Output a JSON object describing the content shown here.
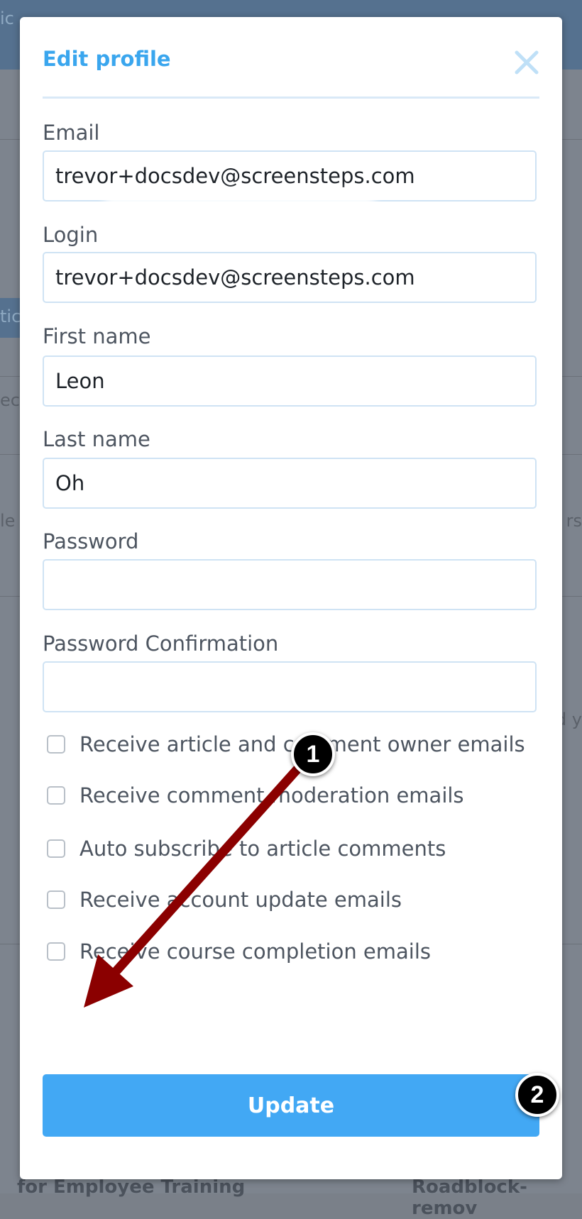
{
  "background": {
    "topbar_fragment": "ic",
    "tab_fragment": "tic",
    "left_fragments": [
      "ect",
      "le"
    ],
    "right_fragments": [
      "rs",
      "d y"
    ],
    "bottom_left": "for Employee Training",
    "bottom_right": "Roadblock-remov"
  },
  "modal": {
    "title": "Edit profile",
    "close_icon": "close-icon",
    "accent_color": "#3aa6ee"
  },
  "form": {
    "email": {
      "label": "Email",
      "value": "trevor+docsdev@screensteps.com"
    },
    "login": {
      "label": "Login",
      "value": "trevor+docsdev@screensteps.com"
    },
    "first_name": {
      "label": "First name",
      "value": "Leon"
    },
    "last_name": {
      "label": "Last name",
      "value": "Oh"
    },
    "password": {
      "label": "Password",
      "value": ""
    },
    "password_confirmation": {
      "label": "Password Confirmation",
      "value": ""
    },
    "checkboxes": [
      {
        "label": "Receive article and comment owner emails",
        "checked": false
      },
      {
        "label": "Receive comment moderation emails",
        "checked": false
      },
      {
        "label": "Auto subscribe to article comments",
        "checked": false
      },
      {
        "label": "Receive account update emails",
        "checked": false
      },
      {
        "label": "Receive course completion emails",
        "checked": false
      }
    ],
    "submit_label": "Update",
    "button_color": "#42a8f4"
  },
  "annotations": {
    "marker_1": "1",
    "marker_2": "2",
    "arrow_color": "#8b0000"
  }
}
